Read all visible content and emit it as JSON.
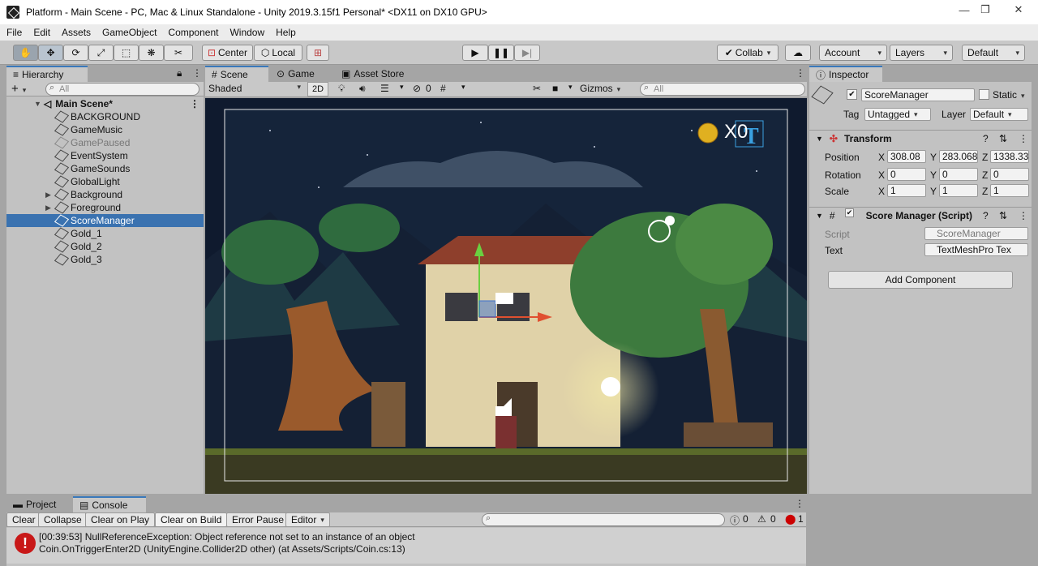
{
  "window": {
    "title": "Platform - Main Scene - PC, Mac & Linux Standalone - Unity 2019.3.15f1 Personal* <DX11 on DX10 GPU>",
    "minimize": "—",
    "maximize": "❐",
    "close": "✕"
  },
  "menu": [
    "File",
    "Edit",
    "Assets",
    "GameObject",
    "Component",
    "Window",
    "Help"
  ],
  "toolbar": {
    "pivot": "Center",
    "space": "Local",
    "collab": "Collab",
    "account": "Account",
    "layers": "Layers",
    "layout": "Default"
  },
  "hierarchy": {
    "tab": "Hierarchy",
    "add": "+",
    "search_placeholder": "All",
    "scene": "Main Scene*",
    "items": [
      {
        "label": "BACKGROUND"
      },
      {
        "label": "GameMusic"
      },
      {
        "label": "GamePaused"
      },
      {
        "label": "EventSystem"
      },
      {
        "label": "GameSounds"
      },
      {
        "label": "GlobalLight"
      },
      {
        "label": "Background"
      },
      {
        "label": "Foreground"
      },
      {
        "label": "ScoreManager"
      },
      {
        "label": "Gold_1"
      },
      {
        "label": "Gold_2"
      },
      {
        "label": "Gold_3"
      }
    ]
  },
  "scene": {
    "tabs": [
      "Scene",
      "Game",
      "Asset Store"
    ],
    "shading": "Shaded",
    "mode2d": "2D",
    "hidden_count": "0",
    "gizmos": "Gizmos",
    "search_placeholder": "All",
    "score_text": "X0"
  },
  "inspector": {
    "tab": "Inspector",
    "object_name": "ScoreManager",
    "static": "Static",
    "tag_label": "Tag",
    "tag": "Untagged",
    "layer_label": "Layer",
    "layer": "Default",
    "transform": {
      "title": "Transform",
      "position_label": "Position",
      "rotation_label": "Rotation",
      "scale_label": "Scale",
      "position": {
        "x": "308.08",
        "y": "283.068",
        "z": "1338.33"
      },
      "rotation": {
        "x": "0",
        "y": "0",
        "z": "0"
      },
      "scale": {
        "x": "1",
        "y": "1",
        "z": "1"
      }
    },
    "script_component": {
      "title": "Score Manager (Script)",
      "script_label": "Script",
      "script_value": "ScoreManager",
      "text_label": "Text",
      "text_value": "TextMeshPro Tex"
    },
    "add_component": "Add Component"
  },
  "console": {
    "tabs": [
      "Project",
      "Console"
    ],
    "buttons": [
      "Clear",
      "Collapse",
      "Clear on Play",
      "Clear on Build",
      "Error Pause",
      "Editor"
    ],
    "counts": {
      "info": "0",
      "warn": "0",
      "error": "1"
    },
    "message_line1": "[00:39:53] NullReferenceException: Object reference not set to an instance of an object",
    "message_line2": "Coin.OnTriggerEnter2D (UnityEngine.Collider2D other) (at Assets/Scripts/Coin.cs:13)"
  }
}
